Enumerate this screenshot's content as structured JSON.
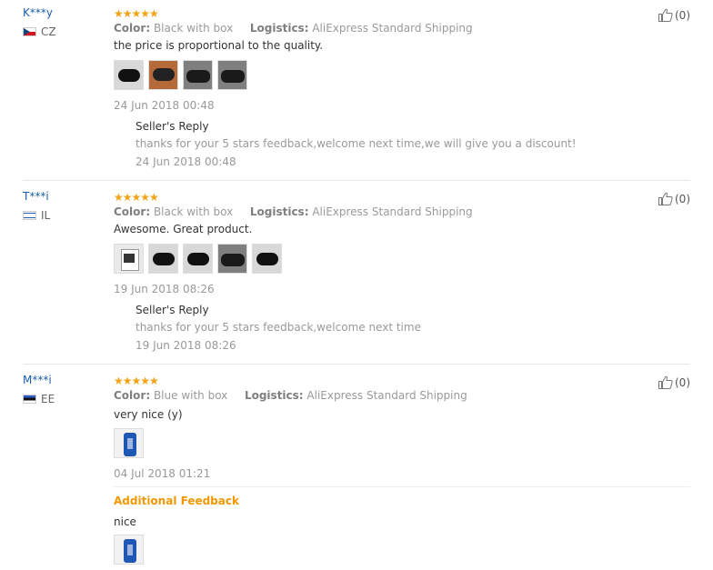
{
  "reviews": [
    {
      "user": "K***y",
      "country": "CZ",
      "stars": "★★★★★",
      "color_label": "Color:",
      "color_value": "Black with box",
      "logistics_label": "Logistics:",
      "logistics_value": "AliExpress Standard Shipping",
      "text": "the price is proportional to the quality.",
      "date": "24 Jun 2018 00:48",
      "helpful": "(0)",
      "reply": {
        "title": "Seller's Reply",
        "text": "thanks for your 5 stars feedback,welcome next time,we will give you a discount!",
        "date": "24 Jun 2018 00:48"
      }
    },
    {
      "user": "T***i",
      "country": "IL",
      "stars": "★★★★★",
      "color_label": "Color:",
      "color_value": "Black with box",
      "logistics_label": "Logistics:",
      "logistics_value": "AliExpress Standard Shipping",
      "text": "Awesome. Great product.",
      "date": "19 Jun 2018 08:26",
      "helpful": "(0)",
      "reply": {
        "title": "Seller's Reply",
        "text": "thanks for your 5 stars feedback,welcome next time",
        "date": "19 Jun 2018 08:26"
      }
    },
    {
      "user": "M***i",
      "country": "EE",
      "stars": "★★★★★",
      "color_label": "Color:",
      "color_value": "Blue with box",
      "logistics_label": "Logistics:",
      "logistics_value": "AliExpress Standard Shipping",
      "text": "very nice (y)",
      "date": "04 Jul 2018 01:21",
      "helpful": "(0)",
      "additional": {
        "title": "Additional Feedback",
        "text": "nice"
      }
    }
  ],
  "colors": {
    "username": "#1b5fa8",
    "stars": "#f3a316",
    "additional_title": "#f39800",
    "muted_text": "#999999"
  },
  "icons": {
    "helpful": "thumbs-up-icon"
  }
}
